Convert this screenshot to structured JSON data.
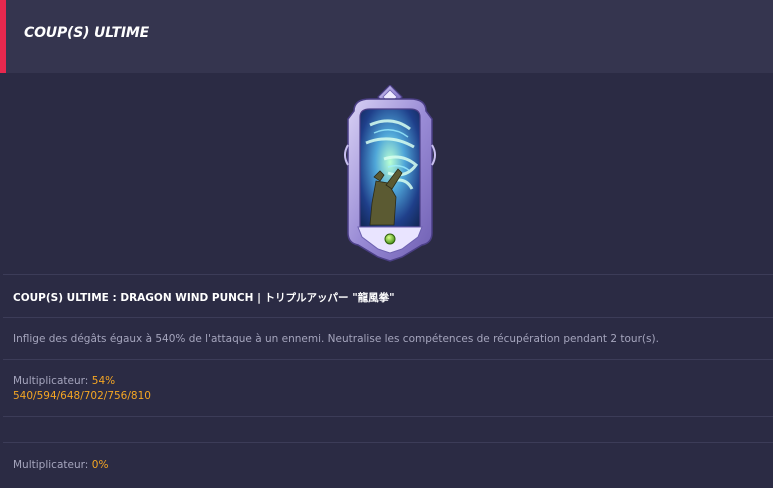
{
  "header": {
    "title": "COUP(S) ULTIME"
  },
  "skill": {
    "name": "COUP(S) ULTIME : DRAGON WIND PUNCH | トリプルアッパー \"龍風拳\"",
    "description": "Inflige des dégâts égaux à 540% de l'attaque à un ennemi. Neutralise les compétences de récupération pendant 2 tour(s).",
    "multiplier_label": "Multiplicateur:",
    "multiplier_value": "54%",
    "multiplier_levels": "540/594/648/702/756/810",
    "multiplier2_label": "Multiplicateur:",
    "multiplier2_value": "0%"
  },
  "icons": {
    "card": "skill-card-art",
    "gem": "green-gem-icon"
  },
  "colors": {
    "accent": "#e8284e",
    "highlight": "#f5a623",
    "header_bg": "#35354f",
    "panel_bg": "#2b2b44"
  }
}
